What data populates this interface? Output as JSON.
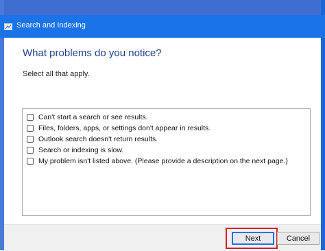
{
  "window": {
    "title": "Search and Indexing",
    "title_icon": "troubleshooter-icon"
  },
  "main": {
    "heading": "What problems do you notice?",
    "instruction": "Select all that apply."
  },
  "problems": [
    {
      "label": "Can't start a search or see results.",
      "checked": false
    },
    {
      "label": "Files, folders, apps, or settings don't appear in results.",
      "checked": false
    },
    {
      "label": "Outlook search doesn't return results.",
      "checked": false
    },
    {
      "label": "Search or indexing is slow.",
      "checked": false
    },
    {
      "label": "My problem isn't listed above. (Please provide a description on the next page.)",
      "checked": false
    }
  ],
  "footer": {
    "next_label": "Next",
    "cancel_label": "Cancel"
  },
  "colors": {
    "titlebar": "#1a73e8",
    "heading": "#1f3f8f",
    "highlight": "#d61f26"
  }
}
